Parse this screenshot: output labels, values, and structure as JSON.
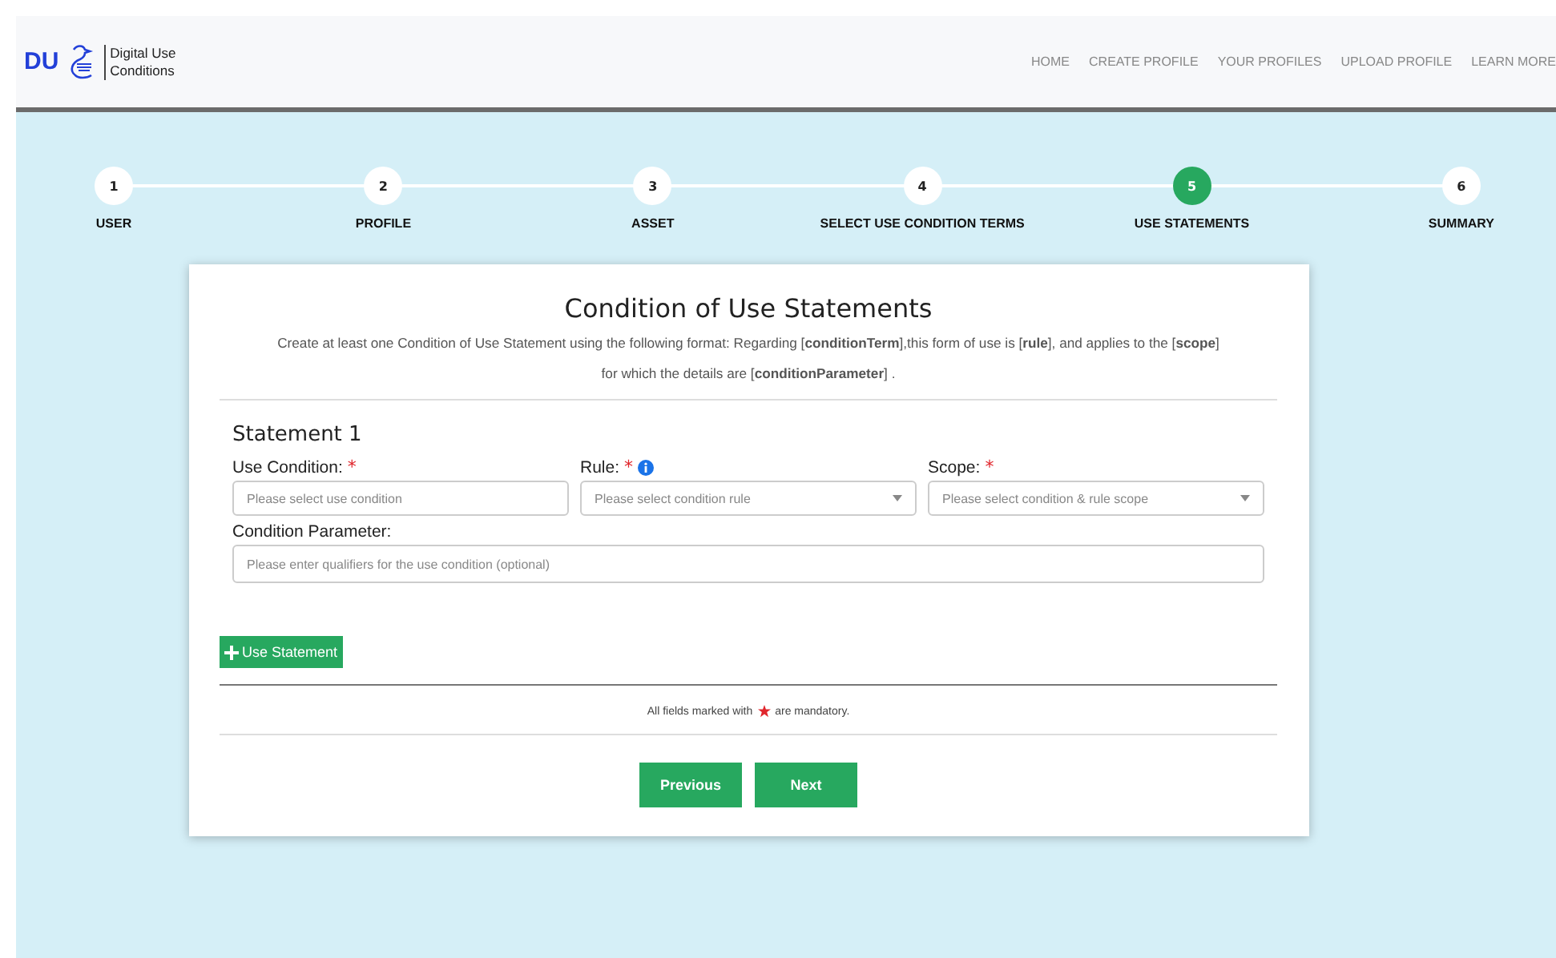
{
  "brand": {
    "logo_text": "DU",
    "name": "Digital Use Conditions"
  },
  "nav": [
    "HOME",
    "CREATE PROFILE",
    "YOUR PROFILES",
    "UPLOAD PROFILE",
    "LEARN MORE"
  ],
  "steps": [
    {
      "number": "1",
      "label": "USER",
      "selected": false
    },
    {
      "number": "2",
      "label": "PROFILE",
      "selected": false
    },
    {
      "number": "3",
      "label": "ASSET",
      "selected": false
    },
    {
      "number": "4",
      "label": "SELECT USE CONDITION TERMS",
      "selected": false
    },
    {
      "number": "5",
      "label": "USE STATEMENTS",
      "selected": true
    },
    {
      "number": "6",
      "label": "SUMMARY",
      "selected": false
    }
  ],
  "card": {
    "title": "Condition of Use Statements",
    "description": "Create at least one Condition of Use Statement using the following format: Regarding [**conditionTerm**],this form of use is [**rule**], and applies to the [**scope**] for which the details are [**conditionParameter**] .",
    "statement_title": "Statement 1",
    "fields": [
      {
        "kind": "input",
        "label": "Use Condition:",
        "required_mark": "*",
        "info": false,
        "placeholder": "Please select use condition"
      },
      {
        "kind": "select",
        "label": "Rule:",
        "required_mark": "*",
        "info": true,
        "placeholder": "Please select condition rule"
      },
      {
        "kind": "select",
        "label": "Scope:",
        "required_mark": "*",
        "info": false,
        "placeholder": "Please select condition & rule scope"
      }
    ],
    "parameter": {
      "label": "Condition Parameter:",
      "placeholder": "Please enter qualifiers for the use condition (optional)"
    },
    "add_button": "Use Statement",
    "note_before": "All fields marked with",
    "note_after": "are mandatory.",
    "buttons": [
      "Previous",
      "Next"
    ]
  }
}
